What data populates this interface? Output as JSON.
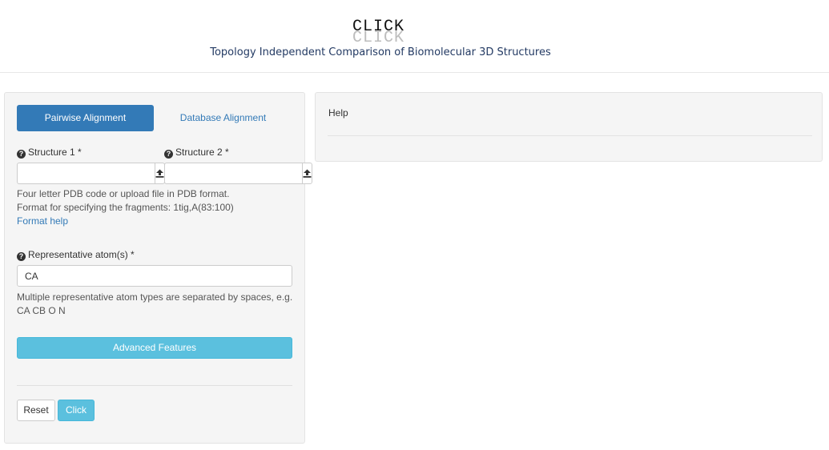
{
  "header": {
    "logo_text": "CLICK",
    "logo_shadow_text": "CLICK",
    "subtitle": "Topology Independent Comparison of Biomolecular 3D Structures"
  },
  "tabs": {
    "pairwise": "Pairwise Alignment",
    "database": "Database Alignment",
    "active": "pairwise"
  },
  "form": {
    "structure1": {
      "label": "Structure 1 *",
      "value": "",
      "icon": "question-circle-icon",
      "upload_icon": "upload-icon"
    },
    "structure2": {
      "label": "Structure 2 *",
      "value": "",
      "icon": "question-circle-icon",
      "upload_icon": "upload-icon"
    },
    "structure_help_line1": "Four letter PDB code or upload file in PDB format.",
    "structure_help_line2": "Format for specifying the fragments: 1tig,A(83:100)",
    "format_help_link": "Format help",
    "atoms": {
      "label": "Representative atom(s) *",
      "value": "CA",
      "help_line1": "Multiple representative atom types are separated by spaces, e.g.",
      "help_line2": "CA CB O N"
    },
    "advanced_button": "Advanced Features",
    "reset_button": "Reset",
    "submit_button": "Click"
  },
  "help_panel": {
    "title": "Help"
  },
  "colors": {
    "primary": "#337ab7",
    "info": "#5bc0de",
    "panel_bg": "#f5f5f5",
    "subtitle": "#233a63"
  }
}
